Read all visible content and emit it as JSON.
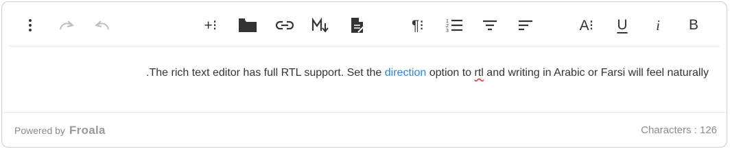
{
  "toolbar": {
    "buttons": [
      {
        "name": "more-options",
        "icon": "vertical-dots-icon"
      },
      {
        "name": "redo",
        "icon": "redo-icon",
        "disabled": true
      },
      {
        "name": "undo",
        "icon": "undo-icon",
        "disabled": true
      },
      {
        "name": "insert-more",
        "icon": "plus-more-icon",
        "label": "+⁝"
      },
      {
        "name": "file-manager",
        "icon": "folder-icon"
      },
      {
        "name": "insert-link",
        "icon": "link-icon"
      },
      {
        "name": "markdown",
        "icon": "markdown-icon"
      },
      {
        "name": "paste-plain",
        "icon": "document-icon"
      },
      {
        "name": "paragraph-more",
        "icon": "pilcrow-icon",
        "label": "¶⁝"
      },
      {
        "name": "ordered-list",
        "icon": "ordered-list-icon"
      },
      {
        "name": "align-center",
        "icon": "align-center-icon"
      },
      {
        "name": "align-right",
        "icon": "align-right-icon"
      },
      {
        "name": "text-more",
        "icon": "text-more-icon",
        "label": "A⁝"
      },
      {
        "name": "underline",
        "icon": "underline-icon",
        "label": "U"
      },
      {
        "name": "italic",
        "icon": "italic-icon",
        "label": "i"
      },
      {
        "name": "bold",
        "icon": "bold-icon",
        "label": "B"
      }
    ]
  },
  "content": {
    "before_link": "The rich text editor has full RTL support. Set the ",
    "link_text": "direction",
    "middle": " option to ",
    "misspelled": "rtl",
    "after": " and writing in Arabic or Farsi will feel naturally."
  },
  "footer": {
    "powered_by": "Powered by",
    "brand": "Froala",
    "characters_label": "Characters : 126"
  },
  "colors": {
    "link": "#1e88e5",
    "border": "#cccccc",
    "muted_text": "#8a8a8a",
    "disabled_icon": "#bdbdbd"
  }
}
